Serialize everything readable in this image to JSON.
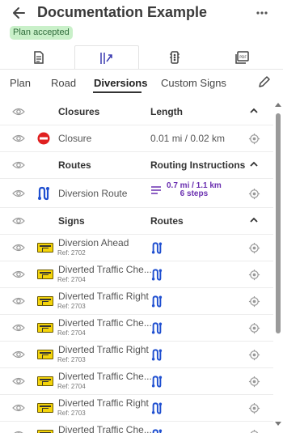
{
  "header": {
    "title": "Documentation Example",
    "badge": "Plan accepted",
    "badge_color": "#c9f0c9",
    "icons": [
      "back-arrow-icon",
      "more-vertical-icon"
    ]
  },
  "top_tabs": [
    {
      "icon": "document-icon",
      "active": false
    },
    {
      "icon": "traffic-plan-icon",
      "active": true
    },
    {
      "icon": "signal-icon",
      "active": false
    },
    {
      "icon": "pdf-icon",
      "active": false
    }
  ],
  "sub_tabs": {
    "items": [
      "Plan",
      "Road",
      "Diversions",
      "Custom Signs"
    ],
    "active": "Diversions",
    "edit_icon": "pencil-icon"
  },
  "sections": {
    "closures": {
      "title": "Closures",
      "col2": "Length"
    },
    "closure_row": {
      "name": "Closure",
      "value": "0.01 mi / 0.02 km"
    },
    "routes": {
      "title": "Routes",
      "col2": "Routing Instructions"
    },
    "route_row": {
      "name": "Diversion Route",
      "distance": "0.7 mi / 1.1 km",
      "steps": "6 steps"
    },
    "signs": {
      "title": "Signs",
      "col2": "Routes"
    }
  },
  "signs": [
    {
      "name": "Diversion Ahead",
      "ref": "Ref: 2702"
    },
    {
      "name": "Diverted Traffic Che...",
      "ref": "Ref: 2704"
    },
    {
      "name": "Diverted Traffic Right",
      "ref": "Ref: 2703"
    },
    {
      "name": "Diverted Traffic Che...",
      "ref": "Ref: 2704"
    },
    {
      "name": "Diverted Traffic Right",
      "ref": "Ref: 2703"
    },
    {
      "name": "Diverted Traffic Che...",
      "ref": "Ref: 2704"
    },
    {
      "name": "Diverted Traffic Right",
      "ref": "Ref: 2703"
    },
    {
      "name": "Diverted Traffic Che...",
      "ref": ""
    }
  ],
  "colors": {
    "route_accent": "#1f4fd0",
    "route_text": "#6a2fb0",
    "closure_red": "#e02020",
    "sign_yellow": "#f4d40a"
  }
}
